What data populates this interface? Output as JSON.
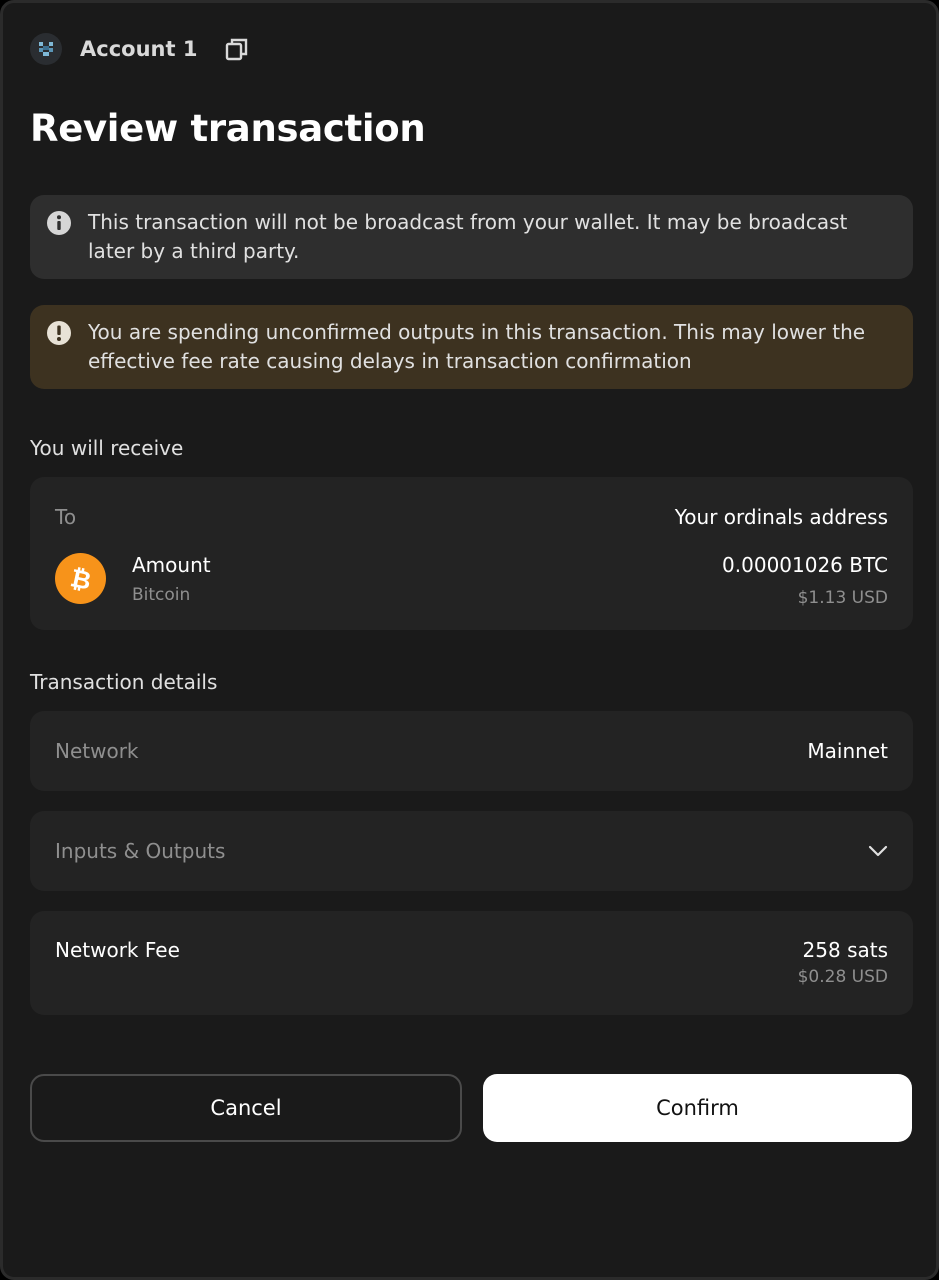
{
  "header": {
    "account_name": "Account 1"
  },
  "title": "Review transaction",
  "banners": {
    "info_text": "This transaction will not be broadcast from your wallet. It may be broadcast later by a third party.",
    "warning_text": "You are spending unconfirmed outputs in this transaction. This may lower the effective fee rate causing delays in transaction confirmation"
  },
  "receive": {
    "section_label": "You will receive",
    "to_label": "To",
    "to_value": "Your ordinals address",
    "amount_label": "Amount",
    "asset_name": "Bitcoin",
    "amount_value": "0.00001026 BTC",
    "amount_usd": "$1.13 USD"
  },
  "details": {
    "section_label": "Transaction details",
    "network_label": "Network",
    "network_value": "Mainnet",
    "io_label": "Inputs & Outputs",
    "fee_label": "Network Fee",
    "fee_value": "258 sats",
    "fee_usd": "$0.28 USD"
  },
  "actions": {
    "cancel_label": "Cancel",
    "confirm_label": "Confirm"
  },
  "colors": {
    "bitcoin": "#f7931a",
    "warning_bg": "#3d3220",
    "info_bg": "#2e2e2e",
    "card_bg": "#232323"
  },
  "icons": [
    "account-avatar-icon",
    "copy-icon",
    "info-icon",
    "alert-icon",
    "bitcoin-icon",
    "chevron-down-icon"
  ]
}
